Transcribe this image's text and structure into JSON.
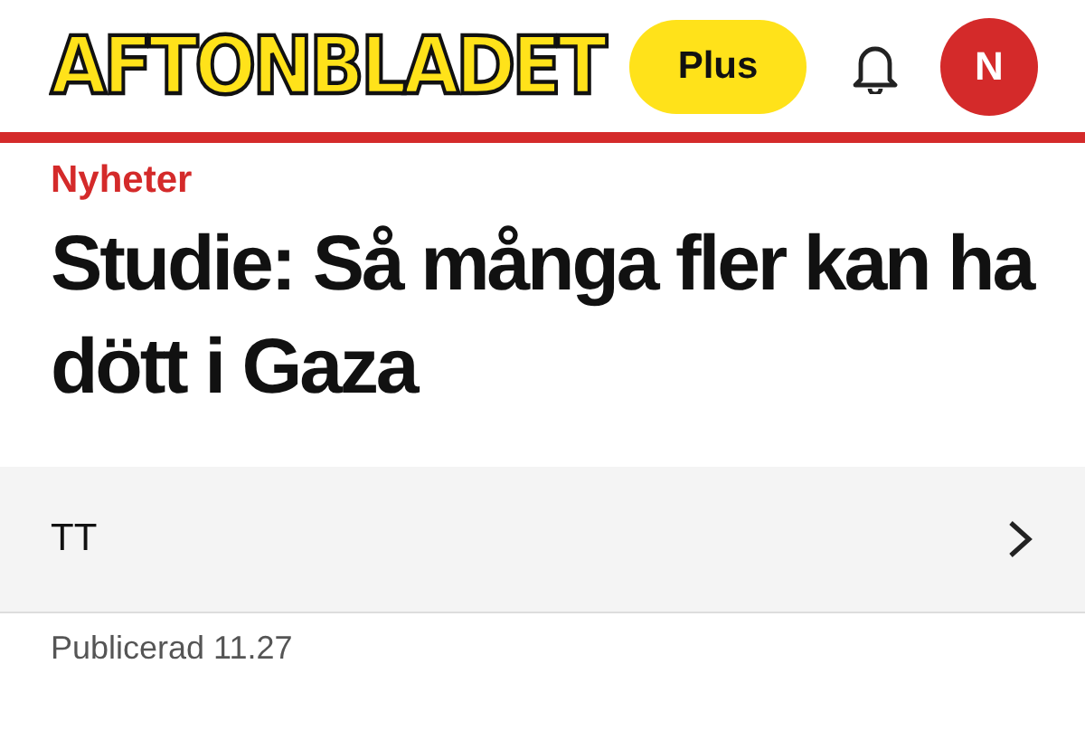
{
  "header": {
    "logo": "AFTONBLADET",
    "plus_button": "Plus",
    "avatar": "N"
  },
  "article": {
    "section": "Nyheter",
    "headline": "Studie: Så många fler kan ha dött i Gaza",
    "author": "TT",
    "published": "Publicerad 11.27"
  }
}
